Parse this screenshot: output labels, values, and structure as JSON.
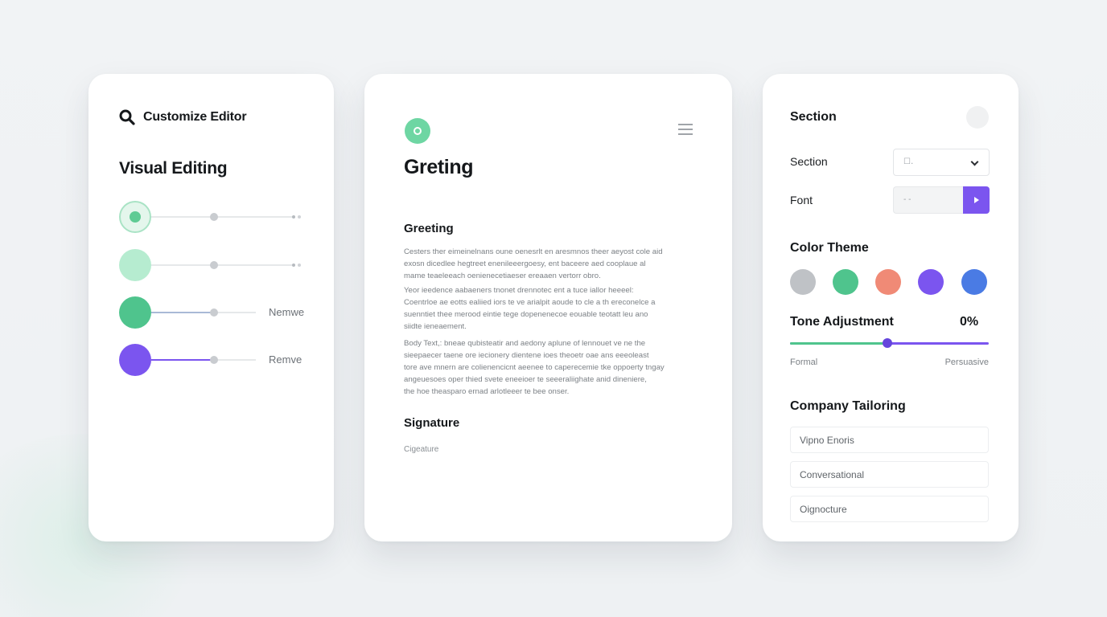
{
  "colors": {
    "green": "#4fc48d",
    "green_light": "#bfead4",
    "purple": "#7b55ef",
    "mint_icon": "#6ed6a3"
  },
  "left": {
    "header_icon": "search-icon",
    "header_title": "Customize Editor",
    "heading": "Visual Editing",
    "rows": [
      {
        "knob_color": "#5fcb94",
        "style": "ring",
        "label": ""
      },
      {
        "knob_color": "#b6ecd0",
        "style": "solid",
        "label": ""
      },
      {
        "knob_color": "#4fc48d",
        "style": "solid",
        "label": "Nemwe",
        "fill_color": "#a9b9d6"
      },
      {
        "knob_color": "#7b55ef",
        "style": "solid",
        "label": "Remve",
        "fill_color": "#7b55ef"
      }
    ]
  },
  "middle": {
    "title": "Greting",
    "greeting_label": "Greeting",
    "paragraphs": [
      [
        "Cesters ther eimeinelnans oune oenesrlt en aresmnos theer aeyost cole aid",
        "exosn dicedlee hegtreet enenileeergoesy, ent baceere aed cooplaue al",
        "mame teaeleeach oenienecetiaeser ereaaen vertorr obro."
      ],
      [
        "Yeor ieedence aabaeners tnonet drennotec ent a tuce iallor heeeel:",
        "Coentrloe ae eotts ealiied iors te ve arialpit aoude to cle a th ereconelce a",
        "suenntiet thee merood eintie tege dopenenecoe eouable teotatt leu ano",
        "siidte ieneaement."
      ],
      [
        "Body Text,: bneae qubisteatir and aedony aplune of lennouet ve ne the",
        "sieepaecer taene ore iecionery dientene ioes theoetr oae ans eeeoleast",
        "tore ave mnern are colienencicnt aeenee to caperecemie tke oppoerty tngay",
        "angeuesoes oper thied svete  eneeioer te seeeraliighate anid dineniere,",
        "the hoe theasparo ernad arlotleeer te bee onser."
      ]
    ],
    "signature_label": "Signature",
    "signature_value": "Cigeature"
  },
  "right": {
    "header": "Section",
    "section_label": "Section",
    "section_value": "☐․",
    "font_label": "Font",
    "font_value": "- -",
    "color_theme_label": "Color Theme",
    "swatches": [
      "#bfc2c6",
      "#4fc48d",
      "#f08a76",
      "#7b55ef",
      "#4a7be4"
    ],
    "tone_label": "Tone Adjustment",
    "tone_value": "0%",
    "tone_min": "Formal",
    "tone_max": "Persuasive",
    "tone_position": 0.49,
    "company_label": "Company Tailoring",
    "company_items": [
      "Vipno Enoris",
      "Conversational",
      "Oignocture"
    ]
  }
}
